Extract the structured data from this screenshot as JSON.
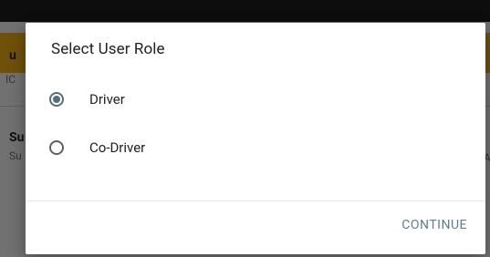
{
  "background": {
    "banner_partial": "u",
    "banner_sub_partial": "IC",
    "row_partial": "Su",
    "row_sub_partial": "Su",
    "right_partial": "A"
  },
  "dialog": {
    "title": "Select User Role",
    "options": [
      {
        "label": "Driver",
        "selected": true
      },
      {
        "label": "Co-Driver",
        "selected": false
      }
    ],
    "continue_label": "CONTINUE"
  },
  "colors": {
    "accent": "#546e7a",
    "button_text": "#607d8b",
    "banner": "#f7b417"
  }
}
